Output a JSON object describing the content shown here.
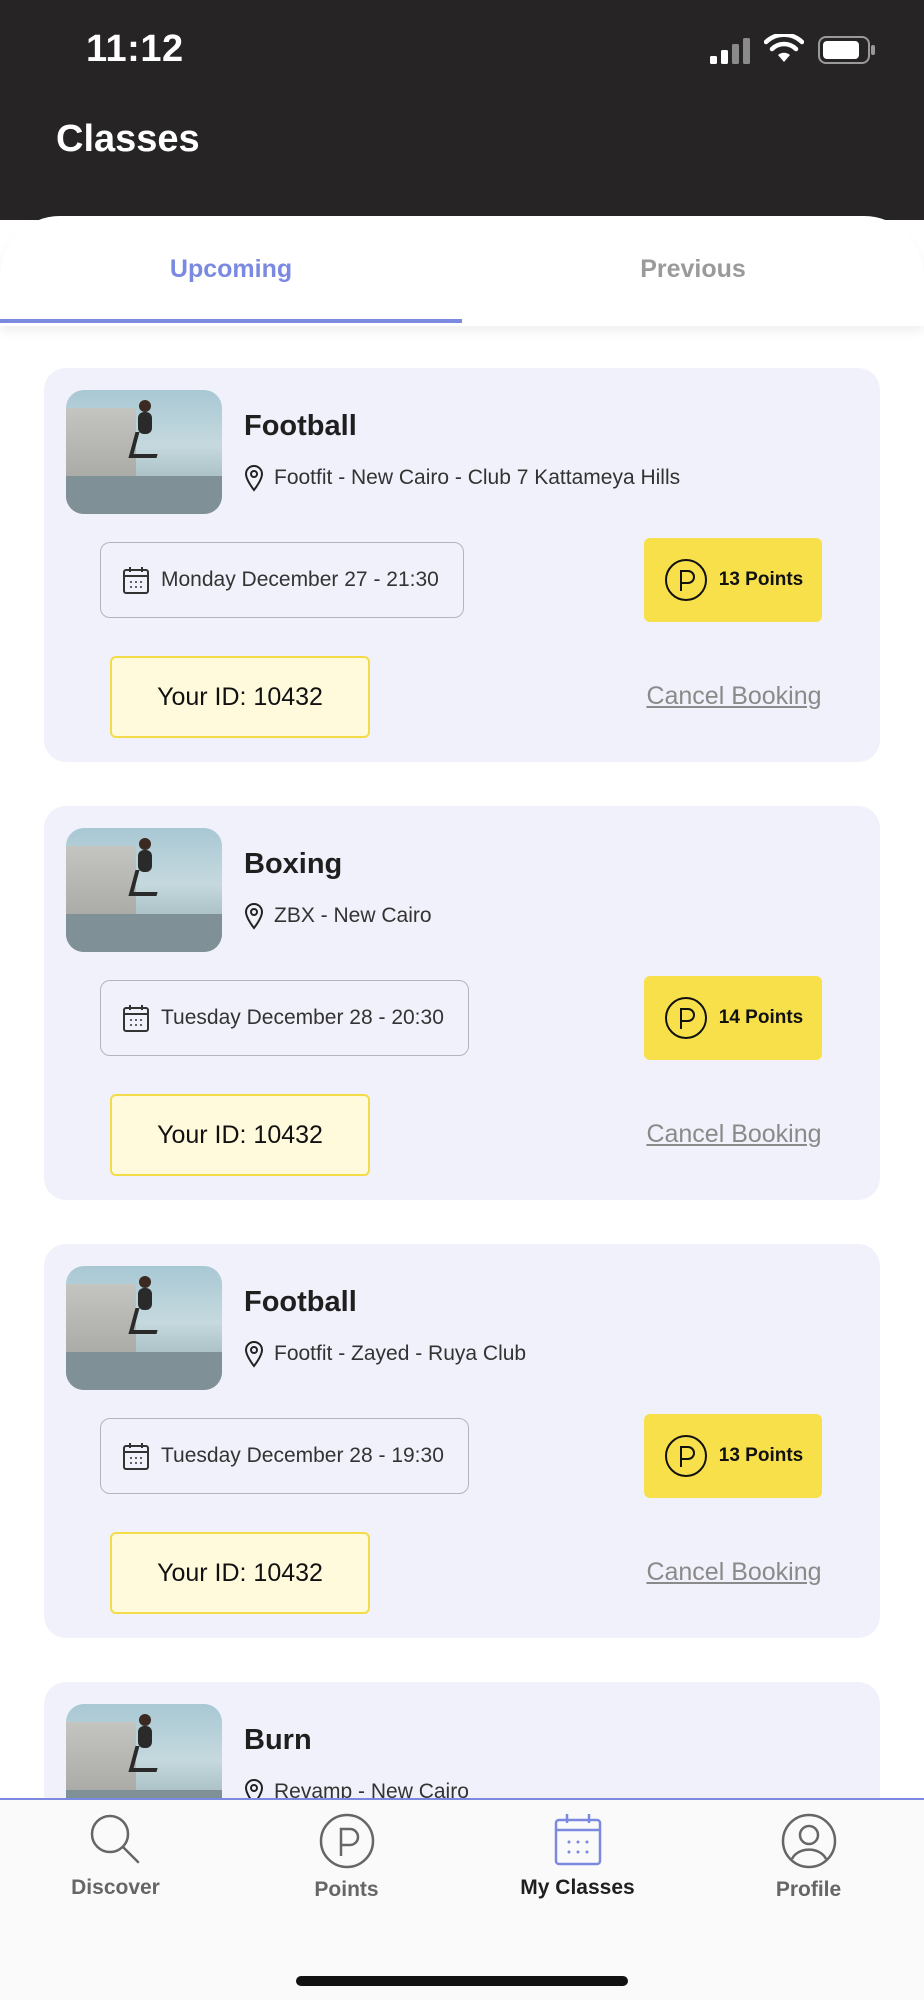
{
  "status": {
    "time": "11:12"
  },
  "header": {
    "title": "Classes"
  },
  "tabs": [
    {
      "label": "Upcoming",
      "active": true
    },
    {
      "label": "Previous",
      "active": false
    }
  ],
  "bookings": [
    {
      "title": "Football",
      "location": "Footfit - New Cairo - Club 7 Kattameya Hills",
      "date": "Monday December 27 - 21:30",
      "points": "13 Points",
      "id_label": "Your ID: 10432",
      "cancel_label": "Cancel Booking"
    },
    {
      "title": "Boxing",
      "location": "ZBX - New Cairo",
      "date": "Tuesday December 28 - 20:30",
      "points": "14 Points",
      "id_label": "Your ID: 10432",
      "cancel_label": "Cancel Booking"
    },
    {
      "title": "Football",
      "location": "Footfit - Zayed - Ruya Club",
      "date": "Tuesday December 28 - 19:30",
      "points": "13 Points",
      "id_label": "Your ID: 10432",
      "cancel_label": "Cancel Booking"
    },
    {
      "title": "Burn",
      "location": "Revamp - New Cairo"
    }
  ],
  "nav": [
    {
      "label": "Discover",
      "icon": "search-icon"
    },
    {
      "label": "Points",
      "icon": "points-icon"
    },
    {
      "label": "My Classes",
      "icon": "calendar-icon",
      "active": true
    },
    {
      "label": "Profile",
      "icon": "profile-icon"
    }
  ],
  "colors": {
    "accent": "#7b8ae0",
    "points_yellow": "#f8e04b",
    "header_dark": "#262425",
    "card_bg": "#f1f1fb"
  }
}
